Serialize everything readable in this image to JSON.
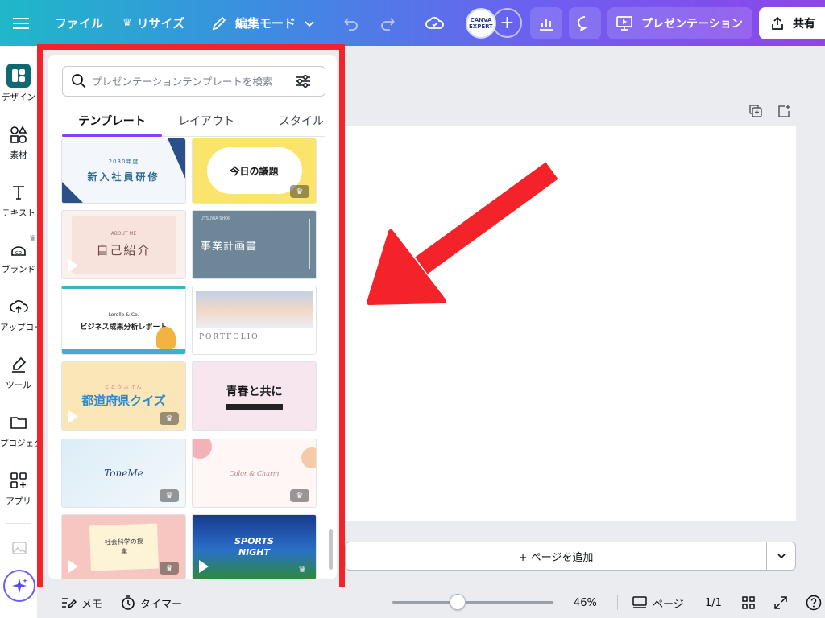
{
  "topbar": {
    "menu_icon": "menu-icon",
    "file": "ファイル",
    "resize": "リサイズ",
    "edit_mode": "編集モード",
    "avatar_text": "CANVA EXPERT",
    "present": "プレゼンテーション",
    "share": "共有"
  },
  "rail": {
    "items": [
      {
        "label": "デザイン",
        "icon": "design-icon"
      },
      {
        "label": "素材",
        "icon": "elements-icon"
      },
      {
        "label": "テキスト",
        "icon": "text-icon"
      },
      {
        "label": "ブランド",
        "icon": "brand-icon"
      },
      {
        "label": "アップロード",
        "icon": "upload-icon"
      },
      {
        "label": "ツール",
        "icon": "tools-icon"
      },
      {
        "label": "プロジェクト",
        "icon": "projects-icon"
      },
      {
        "label": "アプリ",
        "icon": "apps-icon"
      }
    ]
  },
  "panel": {
    "search_placeholder": "プレゼンテーションテンプレートを検索",
    "tabs": [
      "テンプレート",
      "レイアウト",
      "スタイル"
    ],
    "templates": [
      {
        "title": "新入社員研修",
        "subtitle": "2030年度"
      },
      {
        "title": "今日の議題",
        "subtitle": ""
      },
      {
        "title": "自己紹介",
        "subtitle": "ABOUT ME"
      },
      {
        "title": "事業計画書",
        "subtitle": "UTSUWA SHOP"
      },
      {
        "title": "ビジネス成果分析レポート",
        "subtitle": "Lorelle & Co."
      },
      {
        "title": "PORTFOLIO",
        "subtitle": ""
      },
      {
        "title": "都道府県クイズ",
        "subtitle": "とどうふけん"
      },
      {
        "title": "青春と共に",
        "subtitle": ""
      },
      {
        "title": "ToneMe",
        "subtitle": ""
      },
      {
        "title": "Color & Charm",
        "subtitle": ""
      },
      {
        "title": "社会科学の授業",
        "subtitle": ""
      },
      {
        "title": "SPORTS NIGHT",
        "subtitle": ""
      }
    ]
  },
  "main": {
    "add_page": "+ ページを追加"
  },
  "bottombar": {
    "notes": "メモ",
    "timer": "タイマー",
    "zoom": "46%",
    "pages_label": "ページ",
    "page_count": "1/1"
  }
}
